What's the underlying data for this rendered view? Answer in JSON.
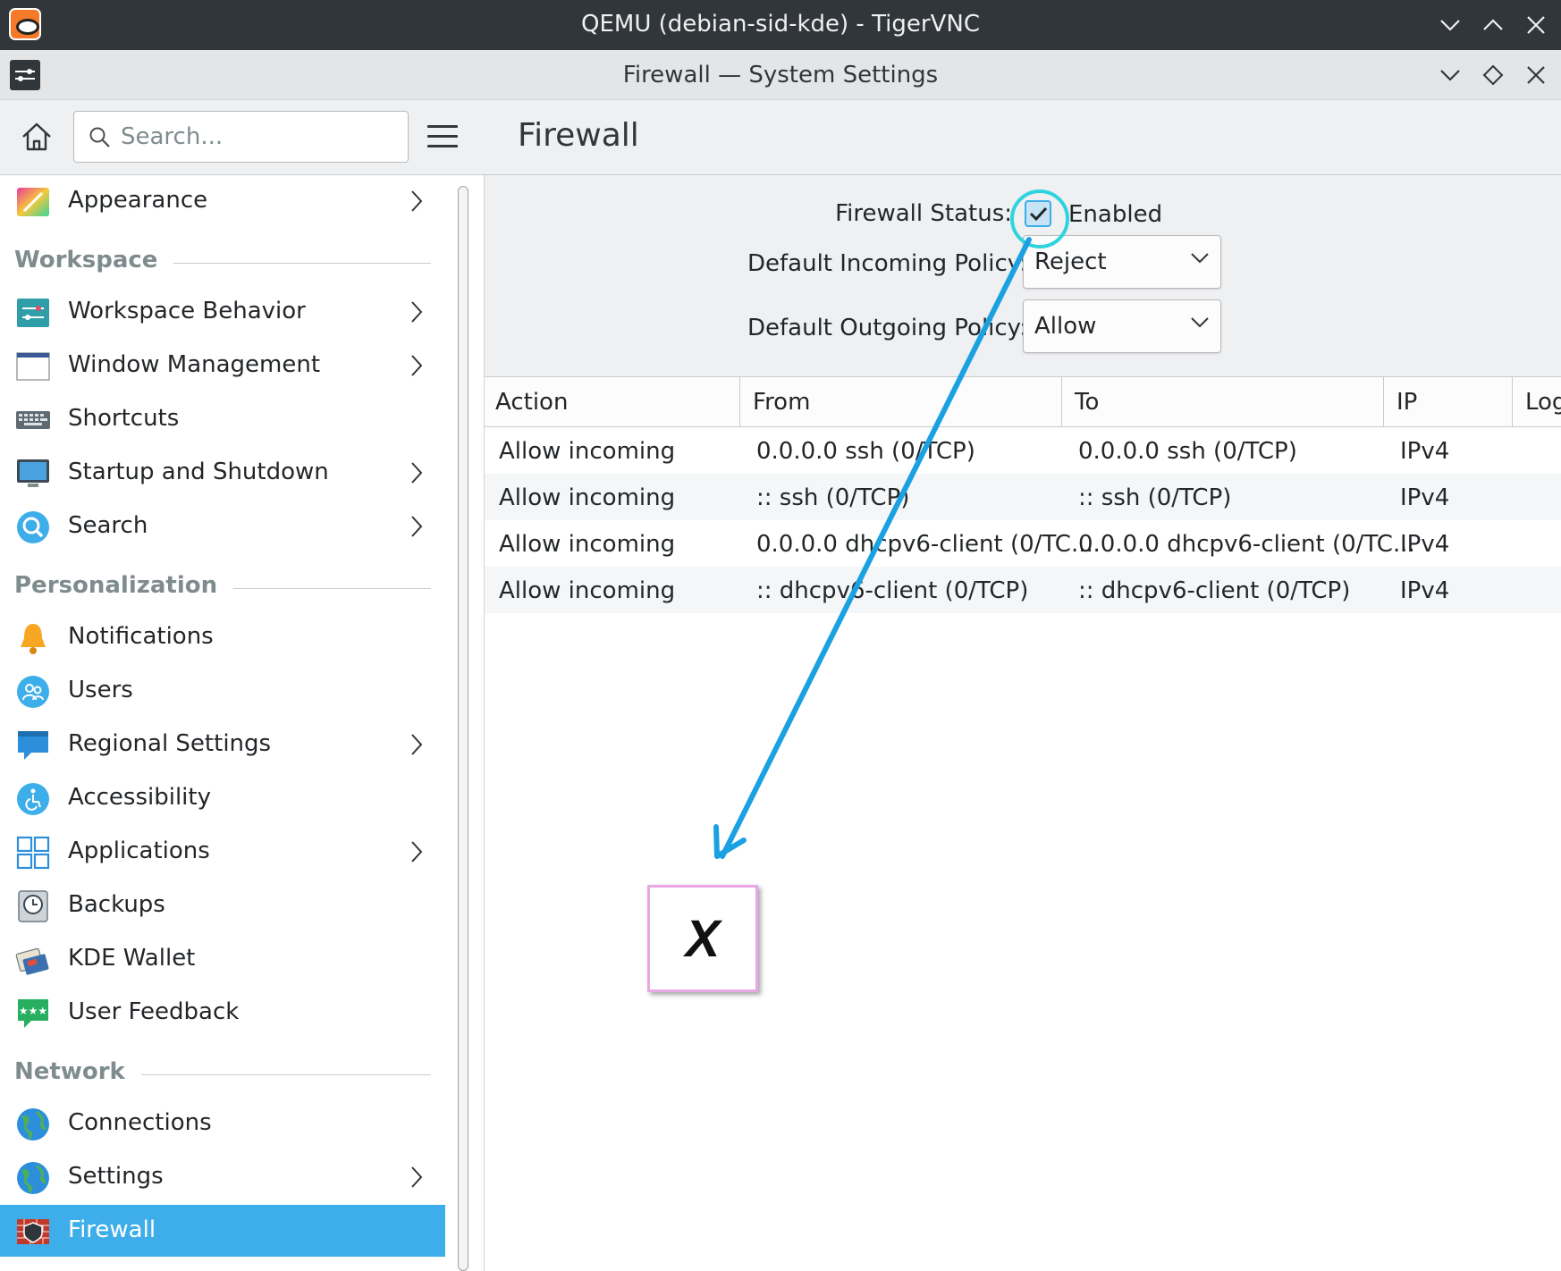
{
  "vnc_window": {
    "title": "QEMU (debian-sid-kde) - TigerVNC"
  },
  "kde_window": {
    "title": "Firewall — System Settings"
  },
  "sidebar": {
    "search_placeholder": "Search...",
    "items": [
      {
        "label": "Appearance",
        "icon": "appearance-icon",
        "has_children": true
      },
      {
        "section": "Workspace"
      },
      {
        "label": "Workspace Behavior",
        "icon": "workspace-behavior-icon",
        "has_children": true
      },
      {
        "label": "Window Management",
        "icon": "window-management-icon",
        "has_children": true
      },
      {
        "label": "Shortcuts",
        "icon": "keyboard-icon",
        "has_children": false
      },
      {
        "label": "Startup and Shutdown",
        "icon": "monitor-icon",
        "has_children": true
      },
      {
        "label": "Search",
        "icon": "search-icon",
        "has_children": true
      },
      {
        "section": "Personalization"
      },
      {
        "label": "Notifications",
        "icon": "bell-icon",
        "has_children": false
      },
      {
        "label": "Users",
        "icon": "users-icon",
        "has_children": false
      },
      {
        "label": "Regional Settings",
        "icon": "speech-bubble-icon",
        "has_children": true
      },
      {
        "label": "Accessibility",
        "icon": "accessibility-icon",
        "has_children": false
      },
      {
        "label": "Applications",
        "icon": "grid-icon",
        "has_children": true
      },
      {
        "label": "Backups",
        "icon": "clock-drive-icon",
        "has_children": false
      },
      {
        "label": "KDE Wallet",
        "icon": "wallet-icon",
        "has_children": false
      },
      {
        "label": "User Feedback",
        "icon": "feedback-icon",
        "has_children": false
      },
      {
        "section": "Network"
      },
      {
        "label": "Connections",
        "icon": "globe-icon",
        "has_children": false
      },
      {
        "label": "Settings",
        "icon": "globe-icon",
        "has_children": true
      },
      {
        "label": "Firewall",
        "icon": "firewall-icon",
        "has_children": false,
        "selected": true
      }
    ]
  },
  "main": {
    "title": "Firewall",
    "status_label": "Firewall Status:",
    "status_checked": true,
    "status_value": "Enabled",
    "incoming_label": "Default Incoming Policy:",
    "incoming_value": "Reject",
    "outgoing_label": "Default Outgoing Policy:",
    "outgoing_value": "Allow",
    "table": {
      "headers": [
        "Action",
        "From",
        "To",
        "IP",
        "Log"
      ],
      "rows": [
        [
          "Allow incoming",
          "0.0.0.0 ssh (0/TCP)",
          "0.0.0.0 ssh (0/TCP)",
          "IPv4"
        ],
        [
          "Allow incoming",
          ":: ssh (0/TCP)",
          ":: ssh (0/TCP)",
          "IPv4"
        ],
        [
          "Allow incoming",
          "0.0.0.0 dhcpv6-client (0/TC...",
          "0.0.0.0 dhcpv6-client (0/TC...",
          "IPv4"
        ],
        [
          "Allow incoming",
          ":: dhcpv6-client (0/TCP)",
          ":: dhcpv6-client (0/TCP)",
          "IPv4"
        ]
      ]
    }
  },
  "annotation": {
    "target_mark": "X",
    "arrow_color": "#1ba1e2",
    "highlight_color": "#2fd3df"
  },
  "colors": {
    "accent": "#3daee9",
    "titlebar_dark": "#31363b",
    "window_bg": "#eff0f1"
  }
}
